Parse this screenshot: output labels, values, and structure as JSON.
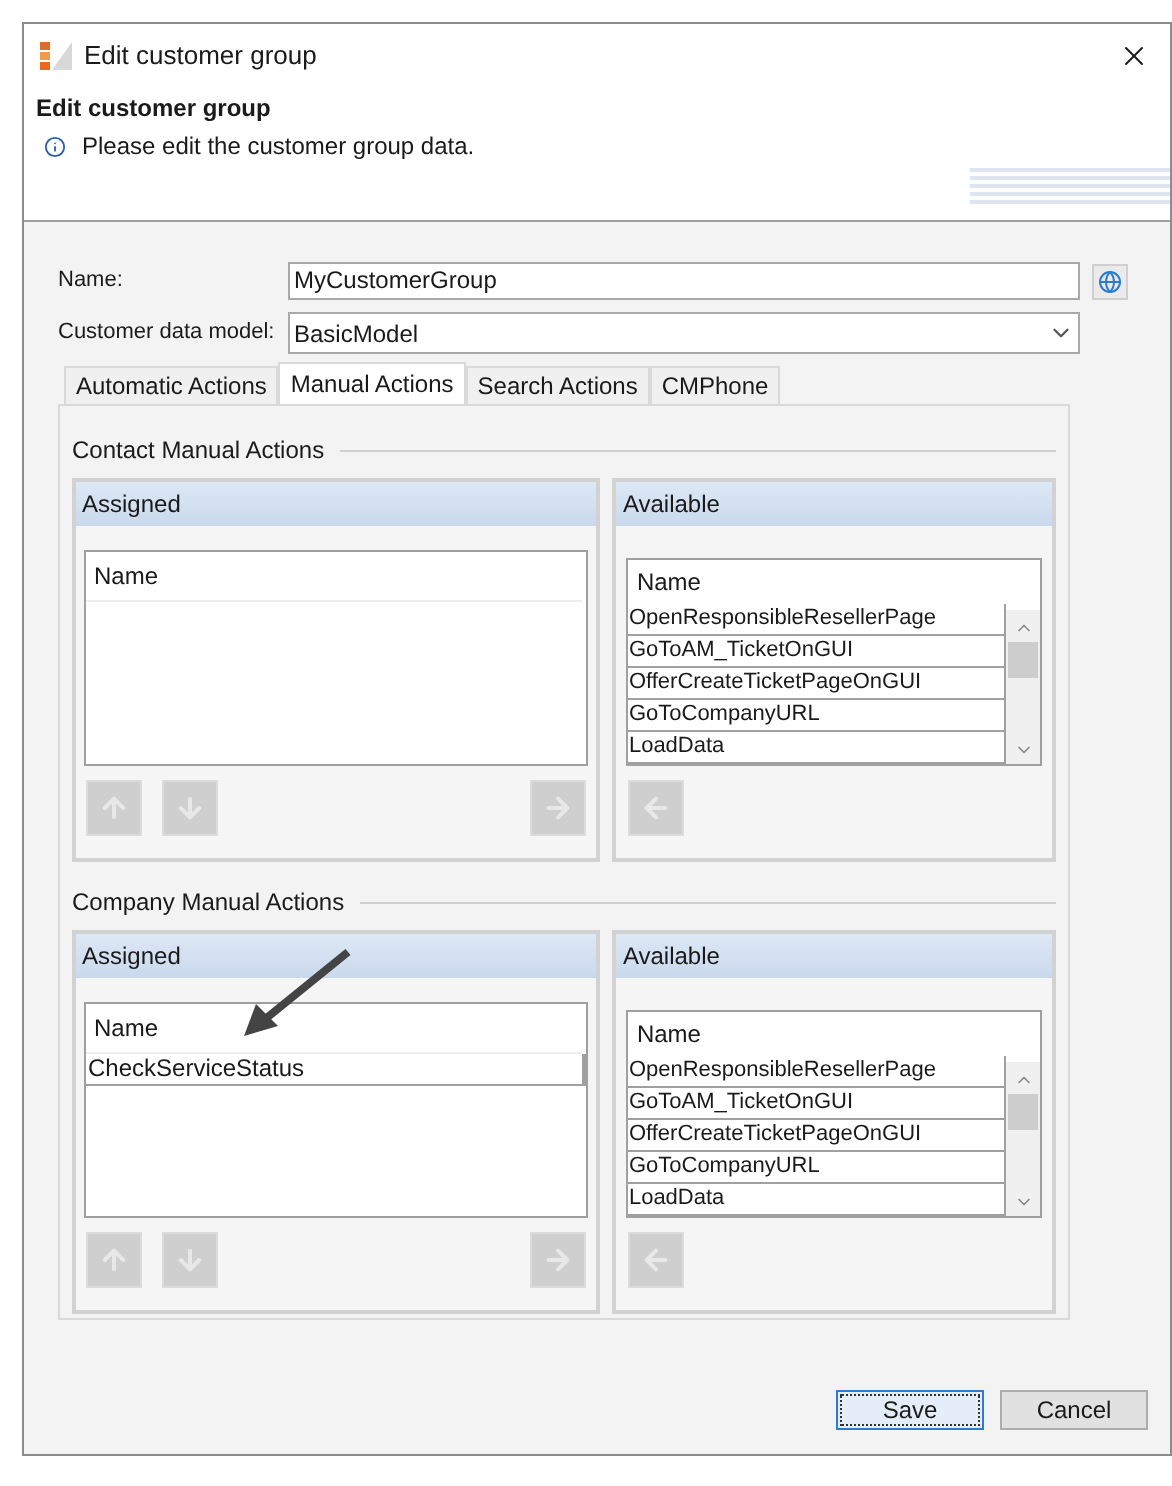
{
  "window": {
    "title": "Edit customer group"
  },
  "header": {
    "title": "Edit customer group",
    "info": "Please edit the customer group data."
  },
  "fields": [
    {
      "kind": "text",
      "label": "Name:",
      "value": "MyCustomerGroup"
    },
    {
      "kind": "dropdown",
      "label": "Customer data model:",
      "value": "BasicModel"
    }
  ],
  "tabs": [
    {
      "label": "Automatic Actions",
      "selected": false
    },
    {
      "label": "Manual Actions",
      "selected": true
    },
    {
      "label": "Search Actions",
      "selected": false
    },
    {
      "label": "CMPhone",
      "selected": false
    }
  ],
  "sections": [
    {
      "title": "Contact Manual Actions",
      "assigned": {
        "title": "Assigned",
        "column": "Name"
      },
      "available": {
        "title": "Available",
        "column": "Name",
        "rows": [
          "OpenResponsibleResellerPage",
          "GoToAM_TicketOnGUI",
          "OfferCreateTicketPageOnGUI",
          "GoToCompanyURL",
          "LoadData"
        ]
      },
      "annotated": false
    },
    {
      "title": "Company Manual Actions",
      "assigned": {
        "title": "Assigned",
        "column": "Name",
        "rows": [
          "CheckServiceStatus"
        ]
      },
      "available": {
        "title": "Available",
        "column": "Name",
        "rows": [
          "OpenResponsibleResellerPage",
          "GoToAM_TicketOnGUI",
          "OfferCreateTicketPageOnGUI",
          "GoToCompanyURL",
          "LoadData"
        ]
      },
      "annotated": true
    }
  ],
  "move_buttons_disabled": true,
  "buttons": [
    {
      "label": "Save",
      "selected": true
    },
    {
      "label": "Cancel",
      "selected": false
    }
  ]
}
